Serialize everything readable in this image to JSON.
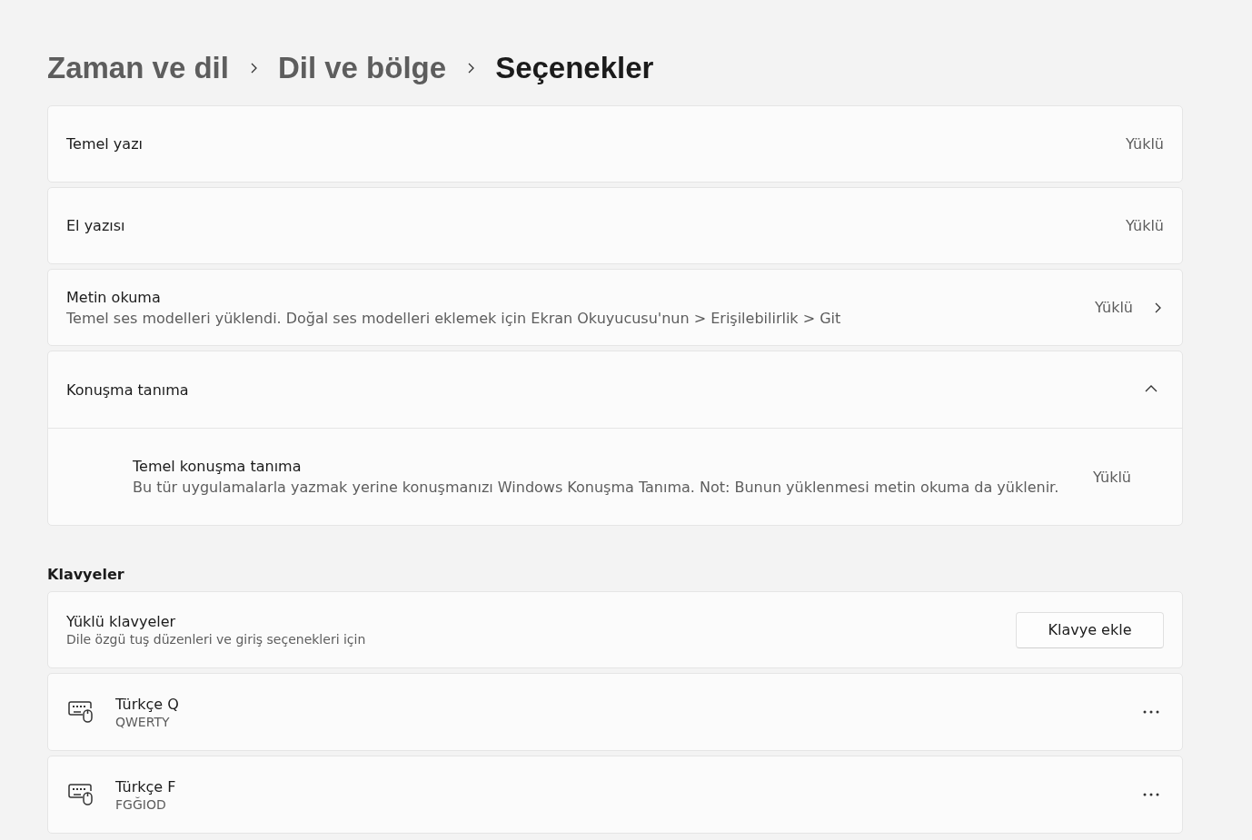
{
  "breadcrumb": [
    {
      "label": "Zaman ve dil",
      "current": false
    },
    {
      "label": "Dil ve bölge",
      "current": false
    },
    {
      "label": "Seçenekler",
      "current": true
    }
  ],
  "options": [
    {
      "kind": "status",
      "title": "Temel yazı",
      "status": "Yüklü"
    },
    {
      "kind": "status",
      "title": "El yazısı",
      "status": "Yüklü"
    },
    {
      "kind": "link",
      "title": "Metin okuma",
      "description": "Temel ses modelleri yüklendi. Doğal ses modelleri eklemek için Ekran Okuyucusu'nun > Erişilebilirlik > Git",
      "status": "Yüklü"
    }
  ],
  "speech": {
    "title": "Konuşma tanıma",
    "expanded": true,
    "items": [
      {
        "title": "Temel konuşma tanıma",
        "description": "Bu tür uygulamalarla yazmak yerine konuşmanızı Windows Konuşma Tanıma. Not: Bunun yüklenmesi metin okuma da yüklenir.",
        "status": "Yüklü"
      }
    ]
  },
  "keyboards": {
    "heading": "Klavyeler",
    "title": "Yüklü klavyeler",
    "description": "Dile özgü tuş düzenleri ve giriş seçenekleri için",
    "button": "Klavye ekle",
    "items": [
      {
        "name": "Türkçe Q",
        "layout": "QWERTY"
      },
      {
        "name": "Türkçe F",
        "layout": "FGĞIOD"
      }
    ]
  }
}
